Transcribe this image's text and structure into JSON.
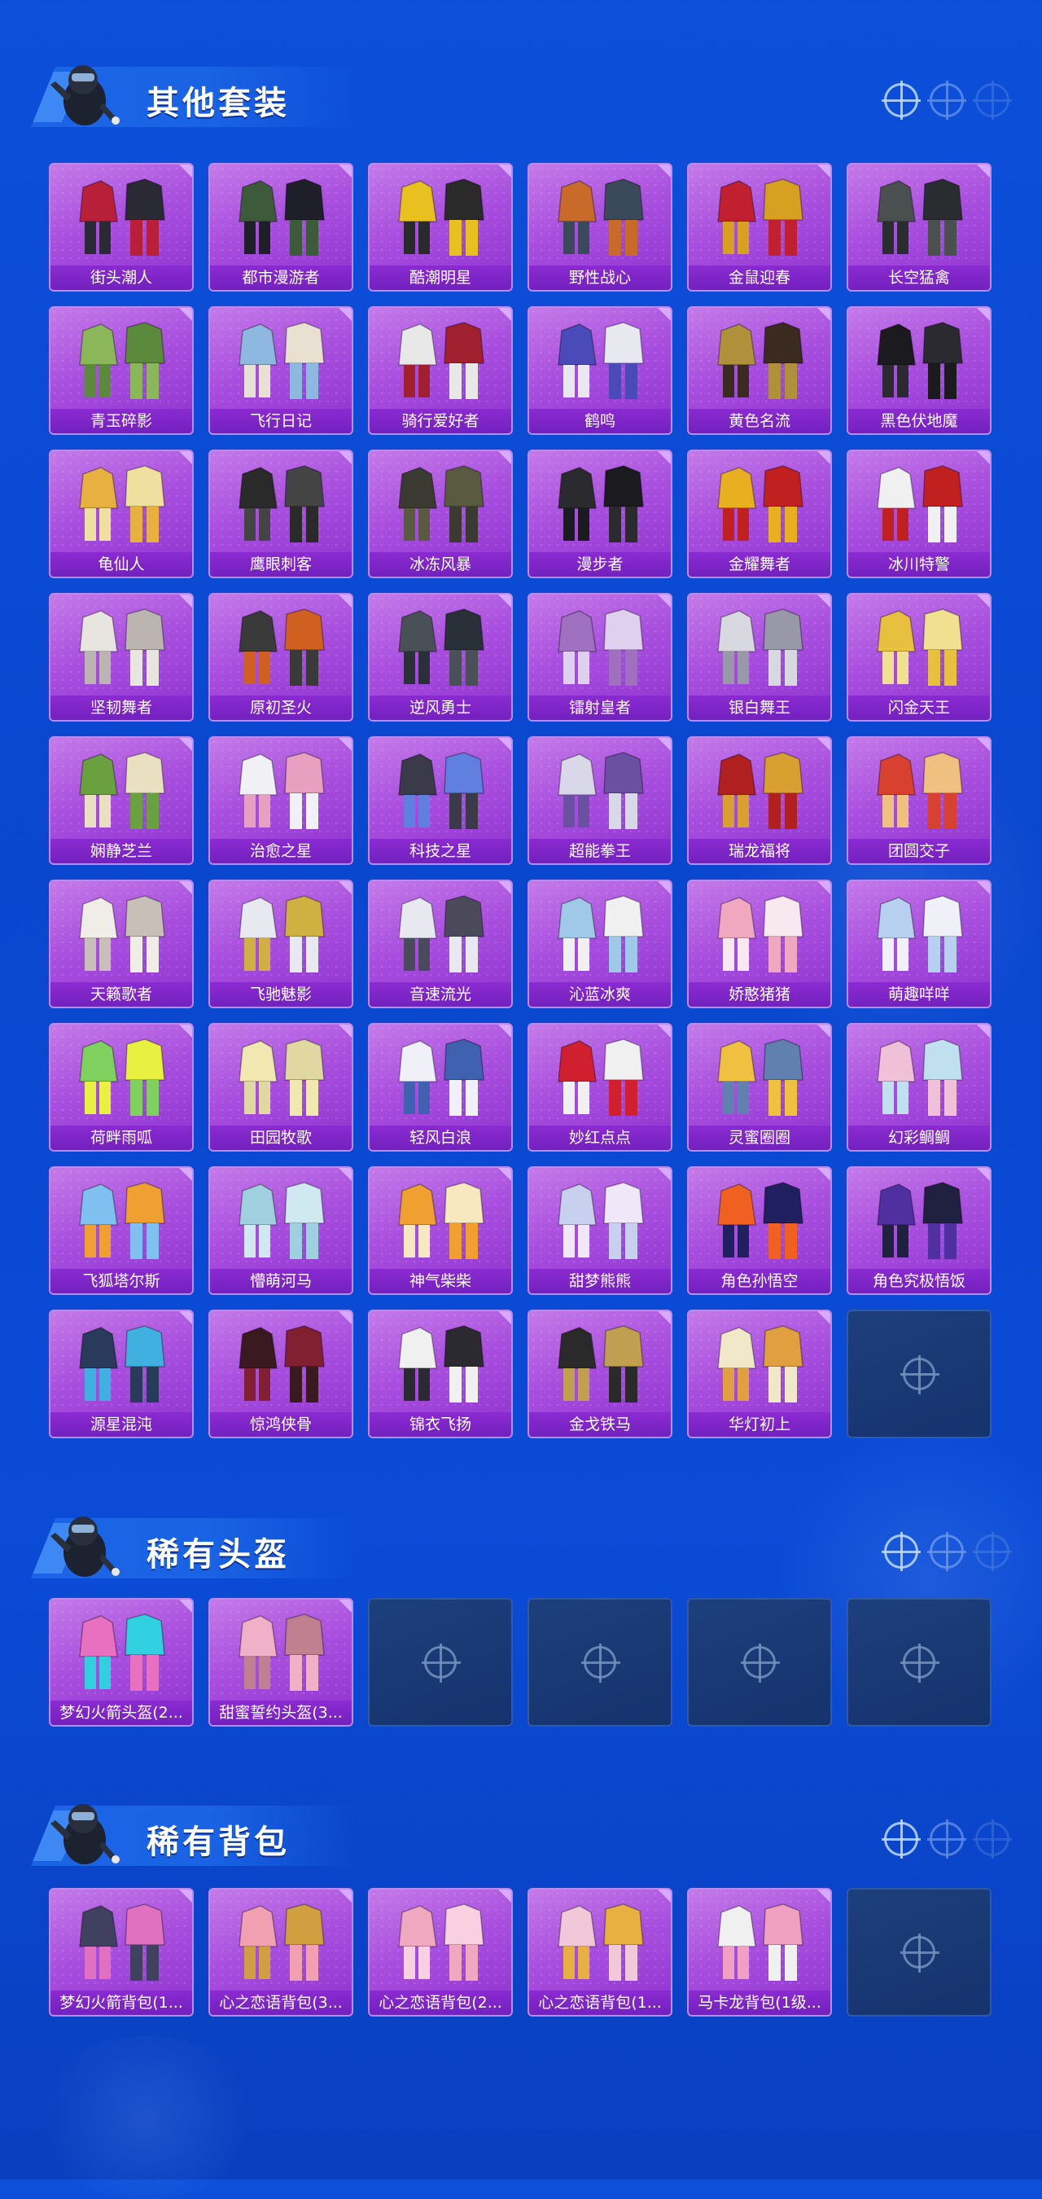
{
  "colors": {
    "bg": "#0b4bd6",
    "card": "#a94fdf",
    "label": "#7a24c4",
    "empty": "#1a3a75"
  },
  "sections": [
    {
      "title": "其他套装",
      "items": [
        {
          "name": "街头潮人",
          "art": "red-jacket-outfit",
          "c1": "#b8203a",
          "c2": "#2a2a35"
        },
        {
          "name": "都市漫游者",
          "art": "green-hoodie-outfit",
          "c1": "#3d5a3a",
          "c2": "#1f1f2a"
        },
        {
          "name": "酷潮明星",
          "art": "yellow-puffer-outfit",
          "c1": "#e8c020",
          "c2": "#2a2a2a"
        },
        {
          "name": "野性战心",
          "art": "orange-vest-outfit",
          "c1": "#c86a2a",
          "c2": "#3a4a5a"
        },
        {
          "name": "金鼠迎春",
          "art": "red-dress-outfit",
          "c1": "#c02030",
          "c2": "#d8a020"
        },
        {
          "name": "长空猛禽",
          "art": "camo-outfit",
          "c1": "#4a4f50",
          "c2": "#2a2d30"
        },
        {
          "name": "青玉碎影",
          "art": "green-suit-outfit",
          "c1": "#8bb65a",
          "c2": "#5c8a3c"
        },
        {
          "name": "飞行日记",
          "art": "denim-outfit",
          "c1": "#8fb8e0",
          "c2": "#e8e0d0"
        },
        {
          "name": "骑行爱好者",
          "art": "biker-outfit",
          "c1": "#e8e8e8",
          "c2": "#a02030"
        },
        {
          "name": "鹤鸣",
          "art": "blue-hoodie-outfit",
          "c1": "#4a4ab8",
          "c2": "#e8e8f0"
        },
        {
          "name": "黄色名流",
          "art": "tan-suit-outfit",
          "c1": "#b0903a",
          "c2": "#3a2a20"
        },
        {
          "name": "黑色伏地魔",
          "art": "black-hoodie-outfit",
          "c1": "#1a1a1f",
          "c2": "#2a2a30"
        },
        {
          "name": "龟仙人",
          "art": "hawaiian-shirt",
          "c1": "#e8b040",
          "c2": "#f0e0a0"
        },
        {
          "name": "鹰眼刺客",
          "art": "dark-armor-outfit",
          "c1": "#2a2a2a",
          "c2": "#444444"
        },
        {
          "name": "冰冻风暴",
          "art": "tactical-outfit",
          "c1": "#3a3a32",
          "c2": "#5a5a40"
        },
        {
          "name": "漫步者",
          "art": "black-coat-outfit",
          "c1": "#2a2a2f",
          "c2": "#1a1a1f"
        },
        {
          "name": "金耀舞者",
          "art": "gold-hazmat-outfit",
          "c1": "#e8b020",
          "c2": "#c02020"
        },
        {
          "name": "冰川特警",
          "art": "white-suit-outfit",
          "c1": "#f0f0f0",
          "c2": "#c02020"
        },
        {
          "name": "坚韧舞者",
          "art": "white-jumpsuit",
          "c1": "#e8e4e0",
          "c2": "#bcb4b0"
        },
        {
          "name": "原初圣火",
          "art": "flame-armor",
          "c1": "#3a3a3a",
          "c2": "#d06020"
        },
        {
          "name": "逆风勇士",
          "art": "gray-armor",
          "c1": "#4a5058",
          "c2": "#2a3038"
        },
        {
          "name": "镭射皇者",
          "art": "purple-mech-outfit",
          "c1": "#a070c0",
          "c2": "#e0d0f0"
        },
        {
          "name": "银白舞王",
          "art": "silver-outfit",
          "c1": "#d8d8e0",
          "c2": "#9898a8"
        },
        {
          "name": "闪金天王",
          "art": "gold-outfit",
          "c1": "#e8c040",
          "c2": "#f0e090"
        },
        {
          "name": "娴静芝兰",
          "art": "floral-dress",
          "c1": "#6aa040",
          "c2": "#e8e0c0"
        },
        {
          "name": "治愈之星",
          "art": "nurse-outfit",
          "c1": "#f0f0f5",
          "c2": "#e8a0c0"
        },
        {
          "name": "科技之星",
          "art": "tech-suit",
          "c1": "#3a3a4a",
          "c2": "#6080e0"
        },
        {
          "name": "超能拳王",
          "art": "boxer-outfit",
          "c1": "#d8d8e8",
          "c2": "#6a50a0"
        },
        {
          "name": "瑞龙福将",
          "art": "dragon-armor",
          "c1": "#b02020",
          "c2": "#d8a030"
        },
        {
          "name": "团圆交子",
          "art": "red-robe",
          "c1": "#d84030",
          "c2": "#f0c080"
        },
        {
          "name": "天籁歌者",
          "art": "white-coat",
          "c1": "#f0ece8",
          "c2": "#c8c0b8"
        },
        {
          "name": "飞驰魅影",
          "art": "racer-suit",
          "c1": "#e8e8f0",
          "c2": "#d0b040"
        },
        {
          "name": "音速流光",
          "art": "sporty-outfit",
          "c1": "#e8e8f0",
          "c2": "#4a4a5a"
        },
        {
          "name": "沁蓝冰爽",
          "art": "blue-casual",
          "c1": "#a0c8e8",
          "c2": "#f0f0f0"
        },
        {
          "name": "娇憨猪猪",
          "art": "pink-pig-outfit",
          "c1": "#f0a8c0",
          "c2": "#f8e8f0"
        },
        {
          "name": "萌趣咩咩",
          "art": "sheep-outfit",
          "c1": "#b8d0f0",
          "c2": "#f0f0f8"
        },
        {
          "name": "荷畔雨呱",
          "art": "frog-outfit",
          "c1": "#80d060",
          "c2": "#e8f040"
        },
        {
          "name": "田园牧歌",
          "art": "pastoral-outfit",
          "c1": "#f0e8b0",
          "c2": "#e0d8a0"
        },
        {
          "name": "轻风白浪",
          "art": "sailor-outfit",
          "c1": "#f0f0f8",
          "c2": "#4060b0"
        },
        {
          "name": "妙红点点",
          "art": "polka-outfit",
          "c1": "#d02030",
          "c2": "#f0f0f0"
        },
        {
          "name": "灵蜜圈圈",
          "art": "bee-outfit",
          "c1": "#f0c040",
          "c2": "#6080b0"
        },
        {
          "name": "幻彩鲷鲷",
          "art": "pastel-outfit",
          "c1": "#f0c0d8",
          "c2": "#c0e0f0"
        },
        {
          "name": "飞狐塔尔斯",
          "art": "fox-outfit",
          "c1": "#80c0f0",
          "c2": "#f0a030"
        },
        {
          "name": "懵萌河马",
          "art": "hippo-outfit",
          "c1": "#a0d0e0",
          "c2": "#d0e8f0"
        },
        {
          "name": "神气柴柴",
          "art": "shiba-outfit",
          "c1": "#f0a030",
          "c2": "#f8e8c0"
        },
        {
          "name": "甜梦熊熊",
          "art": "bear-outfit",
          "c1": "#c8d0f0",
          "c2": "#f0e8f8"
        },
        {
          "name": "角色孙悟空",
          "art": "goku-figure",
          "c1": "#f06020",
          "c2": "#202060"
        },
        {
          "name": "角色究极悟饭",
          "art": "gohan-figure",
          "c1": "#5030a0",
          "c2": "#202040"
        },
        {
          "name": "源星混沌",
          "art": "cyber-outfit",
          "c1": "#2a3a5a",
          "c2": "#40b0e0"
        },
        {
          "name": "惊鸿侠骨",
          "art": "wuxia-dark",
          "c1": "#3a1a20",
          "c2": "#802030"
        },
        {
          "name": "锦衣飞扬",
          "art": "wuxia-white",
          "c1": "#f0f0f0",
          "c2": "#2a2a30"
        },
        {
          "name": "金戈铁马",
          "art": "golden-general",
          "c1": "#2a2a2a",
          "c2": "#c0a050"
        },
        {
          "name": "华灯初上",
          "art": "lantern-dress",
          "c1": "#f0e8c8",
          "c2": "#e0a040"
        }
      ],
      "empty_count": 1
    },
    {
      "title": "稀有头盔",
      "items": [
        {
          "name": "梦幻火箭头盔(2...",
          "art": "rocket-helmet",
          "c1": "#e870c0",
          "c2": "#30d0e0"
        },
        {
          "name": "甜蜜誓约头盔(3...",
          "art": "sweet-helmet",
          "c1": "#f0b0c8",
          "c2": "#c08090"
        }
      ],
      "empty_count": 4
    },
    {
      "title": "稀有背包",
      "items": [
        {
          "name": "梦幻火箭背包(1...",
          "art": "rocket-backpack",
          "c1": "#404060",
          "c2": "#e070c0"
        },
        {
          "name": "心之恋语背包(3...",
          "art": "heart-backpack-3",
          "c1": "#f0a0b0",
          "c2": "#d0a040"
        },
        {
          "name": "心之恋语背包(2...",
          "art": "heart-backpack-2",
          "c1": "#f0a8c0",
          "c2": "#f8d0e0"
        },
        {
          "name": "心之恋语背包(1...",
          "art": "heart-backpack-1",
          "c1": "#f0c8d8",
          "c2": "#e8b040"
        },
        {
          "name": "马卡龙背包(1级...",
          "art": "macaron-backpack",
          "c1": "#f0f0f0",
          "c2": "#f0a0c0"
        }
      ],
      "empty_count": 1
    }
  ]
}
